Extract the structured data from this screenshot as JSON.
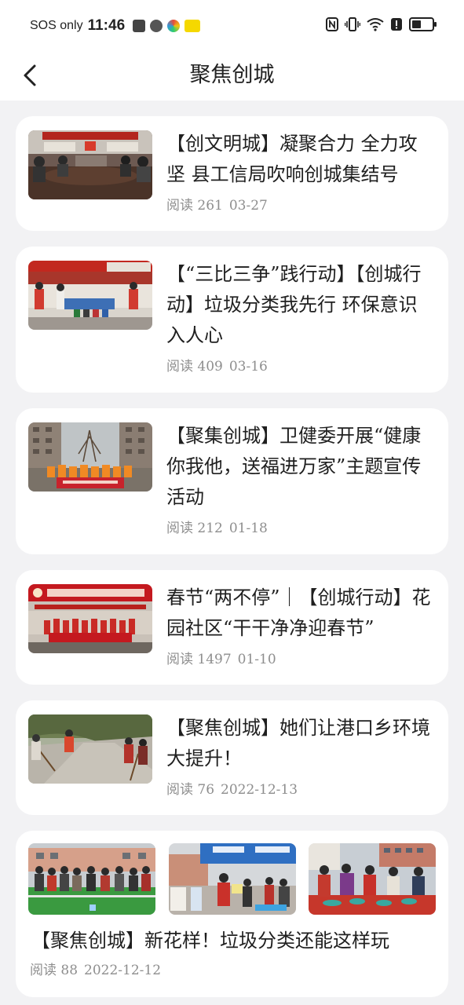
{
  "status_bar": {
    "carrier": "SOS only",
    "time": "11:46",
    "battery_level": 0.45
  },
  "nav": {
    "title": "聚焦创城"
  },
  "articles": [
    {
      "title": "【创文明城】凝聚合力 全力攻坚 县工信局吹响创城集结号",
      "read_label": "阅读 261",
      "date": "03-27"
    },
    {
      "title": "【“三比三争”践行动】【创城行动】垃圾分类我先行 环保意识入人心",
      "read_label": "阅读 409",
      "date": "03-16"
    },
    {
      "title": "【聚集创城】卫健委开展“健康你我他，送福进万家”主题宣传活动",
      "read_label": "阅读 212",
      "date": "01-18"
    },
    {
      "title": "春节“两不停”｜【创城行动】花园社区“干干净净迎春节”",
      "read_label": "阅读 1497",
      "date": "01-10"
    },
    {
      "title": "【聚焦创城】她们让港口乡环境大提升！",
      "read_label": "阅读 76",
      "date": "2022-12-13"
    },
    {
      "title": "【聚焦创城】新花样！垃圾分类还能这样玩",
      "read_label": "阅读 88",
      "date": "2022-12-12"
    }
  ]
}
